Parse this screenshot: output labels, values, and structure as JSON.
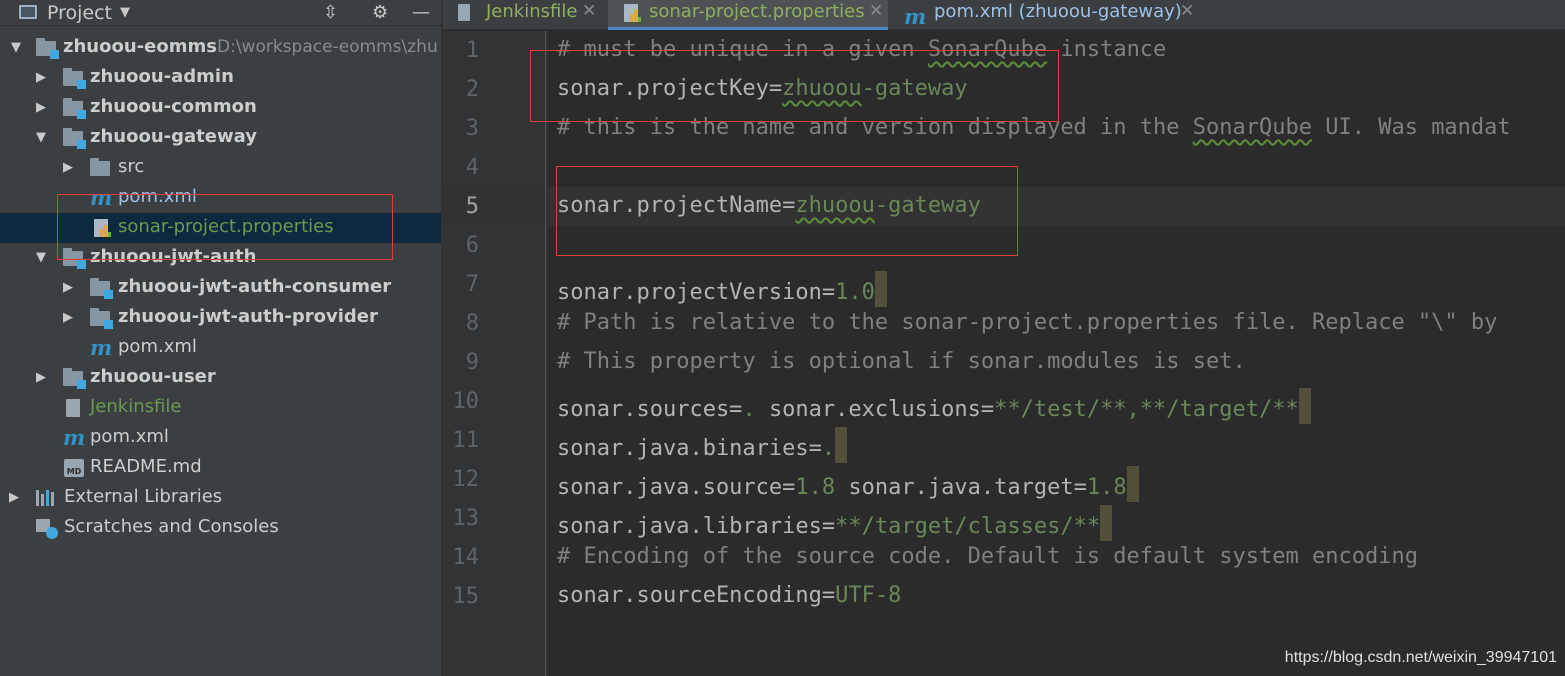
{
  "sidebar": {
    "title": "Project",
    "tree": [
      {
        "label": "zhuoou-eomms",
        "path": "D:\\workspace-eomms\\zhu",
        "bold": true
      },
      {
        "label": "zhuoou-admin",
        "bold": true
      },
      {
        "label": "zhuoou-common",
        "bold": true
      },
      {
        "label": "zhuoou-gateway",
        "bold": true
      },
      {
        "label": "src"
      },
      {
        "label": "pom.xml"
      },
      {
        "label": "sonar-project.properties"
      },
      {
        "label": "zhuoou-jwt-auth",
        "bold": true
      },
      {
        "label": "zhuoou-jwt-auth-consumer",
        "bold": true
      },
      {
        "label": "zhuoou-jwt-auth-provider",
        "bold": true
      },
      {
        "label": "pom.xml"
      },
      {
        "label": "zhuoou-user",
        "bold": true
      },
      {
        "label": "Jenkinsfile"
      },
      {
        "label": "pom.xml"
      },
      {
        "label": "README.md"
      },
      {
        "label": "External Libraries"
      },
      {
        "label": "Scratches and Consoles"
      }
    ]
  },
  "tabs": [
    {
      "label": "Jenkinsfile"
    },
    {
      "label": "sonar-project.properties"
    },
    {
      "label": "pom.xml (zhuoou-gateway)"
    }
  ],
  "icons": {
    "collapse": "collapse-all-icon",
    "settings": "gear-icon",
    "hide": "minimize-icon"
  },
  "editor": {
    "line_numbers": [
      "1",
      "2",
      "3",
      "4",
      "5",
      "6",
      "7",
      "8",
      "9",
      "10",
      "11",
      "12",
      "13",
      "14",
      "15"
    ],
    "current_line": 5,
    "lines": [
      "# must be unique in a given SonarQube instance",
      "sonar.projectKey=zhuoou-gateway",
      "# this is the name and version displayed in the SonarQube UI. Was mandat",
      "",
      "sonar.projectName=zhuoou-gateway",
      "",
      "sonar.projectVersion=1.0",
      "# Path is relative to the sonar-project.properties file. Replace \"\\\" by",
      "# This property is optional if sonar.modules is set.",
      "sonar.sources=. sonar.exclusions=**/test/**,**/target/**",
      "sonar.java.binaries=.",
      "sonar.java.source=1.8 sonar.java.target=1.8",
      "sonar.java.libraries=**/target/classes/**",
      "# Encoding of the source code. Default is default system encoding",
      "sonar.sourceEncoding=UTF-8"
    ]
  },
  "watermark": "https://blog.csdn.net/weixin_39947101",
  "colors": {
    "comment": "#808080",
    "value": "#6a8759",
    "key": "#b3b3b3",
    "selection": "#0d293e",
    "tab_accent": "#4a88c7",
    "annotation_box": "#e23b3b"
  }
}
